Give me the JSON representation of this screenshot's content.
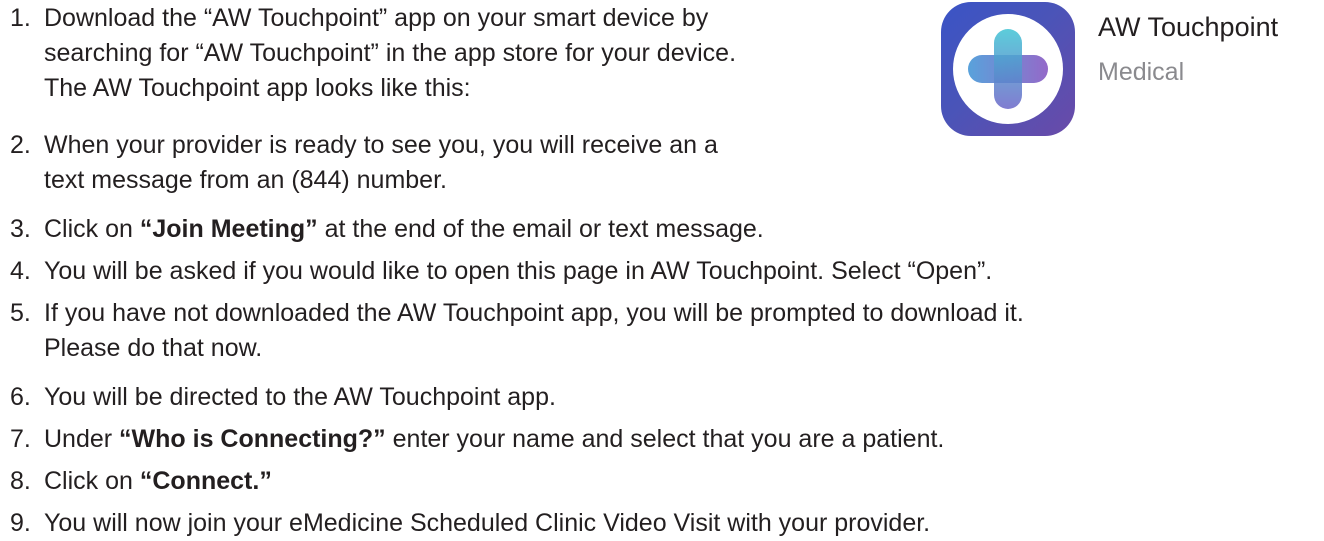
{
  "steps": [
    {
      "number": "1.",
      "lines": [
        "Download the “AW Touchpoint” app on your smart device by",
        "searching for “AW Touchpoint” in the app store for your device.",
        "The AW Touchpoint app looks like this:"
      ]
    },
    {
      "number": "2.",
      "lines": [
        "When your provider is ready to see you, you will receive an a",
        "text message from an (844) number."
      ]
    },
    {
      "number": "3.",
      "before": "Click on ",
      "bold": "“Join Meeting”",
      "after": " at the end of the email or text message."
    },
    {
      "number": "4.",
      "lines": [
        "You will be asked if you would like to open this page in AW Touchpoint. Select “Open”."
      ]
    },
    {
      "number": "5.",
      "lines": [
        "If you have not downloaded the AW Touchpoint app, you will be prompted to download it.",
        "Please do that now."
      ]
    },
    {
      "number": "6.",
      "lines": [
        "You will be directed to the AW Touchpoint app."
      ]
    },
    {
      "number": "7.",
      "before": "Under ",
      "bold": "“Who is Connecting?”",
      "after": " enter your name and select that you are a patient."
    },
    {
      "number": "8.",
      "before": "Click on ",
      "bold": "“Connect.”",
      "after": ""
    },
    {
      "number": "9.",
      "lines": [
        "You will now join your eMedicine Scheduled Clinic Video Visit with your provider."
      ]
    }
  ],
  "app": {
    "name": "AW Touchpoint",
    "category": "Medical",
    "icon": "plus-cross-icon",
    "colors": {
      "icon_bg_start": "#3a54c6",
      "icon_bg_end": "#6a4aa8",
      "cross_left": "#4a9ad8",
      "cross_right": "#8b5cc4",
      "cross_top": "#3fc4d4",
      "cross_bottom": "#6a66c8"
    }
  }
}
